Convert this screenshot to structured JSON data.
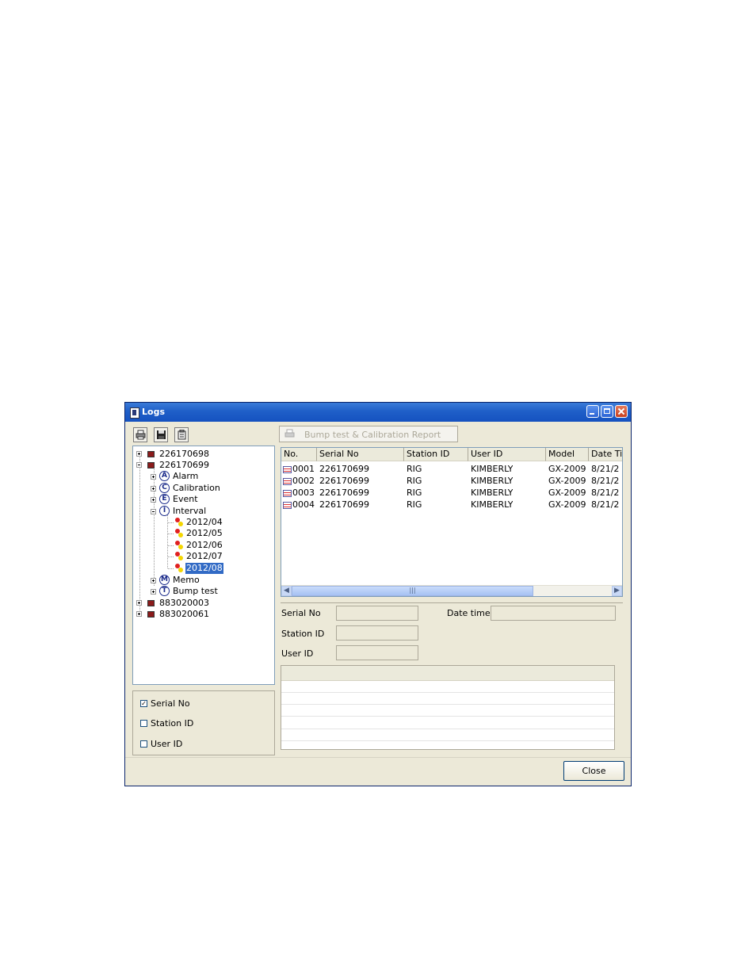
{
  "window": {
    "title": "Logs"
  },
  "toolbar": {
    "report_button": "Bump test & Calibration Report",
    "icons": [
      "printer-icon",
      "save-icon",
      "clipboard-icon"
    ]
  },
  "tree": {
    "devices": [
      "226170698",
      "226170699",
      "883020003",
      "883020061"
    ],
    "categories": [
      {
        "letter": "A",
        "label": "Alarm"
      },
      {
        "letter": "C",
        "label": "Calibration"
      },
      {
        "letter": "E",
        "label": "Event"
      },
      {
        "letter": "I",
        "label": "Interval"
      },
      {
        "letter": "M",
        "label": "Memo"
      },
      {
        "letter": "T",
        "label": "Bump test"
      }
    ],
    "interval_months": [
      "2012/04",
      "2012/05",
      "2012/06",
      "2012/07",
      "2012/08"
    ],
    "selected": "2012/08"
  },
  "filters": [
    {
      "label": "Serial No",
      "checked": true,
      "mark": "✓"
    },
    {
      "label": "Station ID",
      "checked": false,
      "mark": ""
    },
    {
      "label": "User ID",
      "checked": false,
      "mark": ""
    }
  ],
  "table": {
    "columns": [
      "No.",
      "Serial No",
      "Station ID",
      "User ID",
      "Model",
      "Date Ti"
    ],
    "rows": [
      [
        "0001",
        "226170699",
        "RIG",
        "KIMBERLY",
        "GX-2009",
        "8/21/2"
      ],
      [
        "0002",
        "226170699",
        "RIG",
        "KIMBERLY",
        "GX-2009",
        "8/21/2"
      ],
      [
        "0003",
        "226170699",
        "RIG",
        "KIMBERLY",
        "GX-2009",
        "8/21/2"
      ],
      [
        "0004",
        "226170699",
        "RIG",
        "KIMBERLY",
        "GX-2009",
        "8/21/2"
      ]
    ]
  },
  "detail": {
    "serial_label": "Serial No",
    "date_label": "Date time",
    "station_label": "Station ID",
    "user_label": "User ID"
  },
  "buttons": {
    "close": "Close"
  }
}
